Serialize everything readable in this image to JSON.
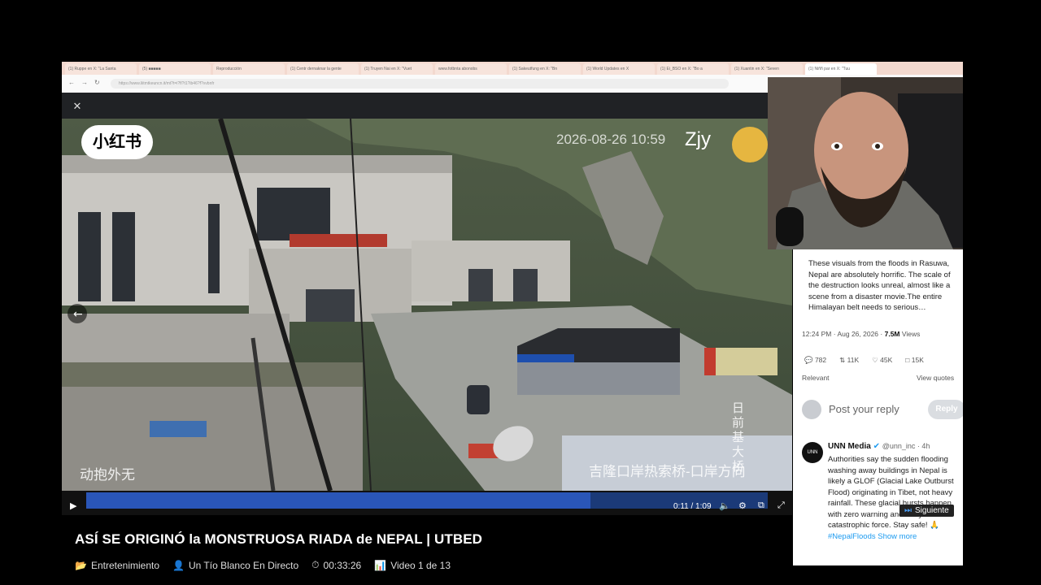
{
  "browser": {
    "tabs": [
      "(1) Ruppe en X: \"La Santa",
      "(5) ■■■■■",
      "Reproducción",
      "(1) Centr dernaknar la gente",
      "(1) Truyen Nai en X: \"Vuet",
      "www.fotbnta abonobs",
      "(1) Sakeutfung en X: \"Bn",
      "(1) World Updates en X",
      "(1) Ei_BSO en X: \"Bo a",
      "(1) Xuantin en X: \"Seven",
      "(1) Niññ par en X: \"Tuu"
    ],
    "active_tab": 10,
    "url": "https://www.liitmtkeuncn.it/mt?t=i?fl?t1?ib46?f?vvbnfr"
  },
  "video": {
    "watermark_logo": "小红书",
    "timestamp": "2026-08-26 10:59",
    "author_tag": "Zjy",
    "caption_left": "动抱外无",
    "caption_right": "吉隆口岸热索桥-口岸方向",
    "caption_vertical": "日前基大桥",
    "time_display": "0:11 / 1:09"
  },
  "tweet1": {
    "text": "These visuals from the floods in Rasuwa, Nepal are absolutely horrific. The scale of the destruction looks unreal, almost like a scene from a disaster movie.The entire Himalayan belt needs to serious…",
    "time": "12:24 PM · Aug 26, 2026 ·",
    "views": "7.5M",
    "views_label": "Views",
    "replies": "782",
    "retweets": "11K",
    "likes": "45K",
    "bookmarks": "15K",
    "relevant": "Relevant",
    "view_quotes": "View quotes",
    "reply_placeholder": "Post your reply",
    "reply_button": "Reply"
  },
  "tweet2": {
    "author": "UNN Media",
    "handle": "@unn_inc · 4h",
    "text_parts": [
      "Authorities say the sudden flooding washing away buildings in Nepal is likely a GLOF (Glacial Lake Outburst Flood) originating in Tibet, not heavy rainfall. These glacial bursts happen with zero warning and carry catastrophic force. Stay safe! 🙏",
      "#NepalFloods",
      "Show more"
    ]
  },
  "overlay": {
    "title": "ASÍ SE ORIGINÓ la MONSTRUOSA RIADA de NEPAL | UTBED",
    "category": "Entretenimiento",
    "channel": "Un Tío Blanco En Directo",
    "duration": "00:33:26",
    "video_index": "Video 1 de 13",
    "next_label": "Siguiente"
  },
  "colors": {
    "progress": "#2a56b8",
    "tab_bar": "#f3d9cf",
    "twitter_blue": "#1d9bf0"
  }
}
